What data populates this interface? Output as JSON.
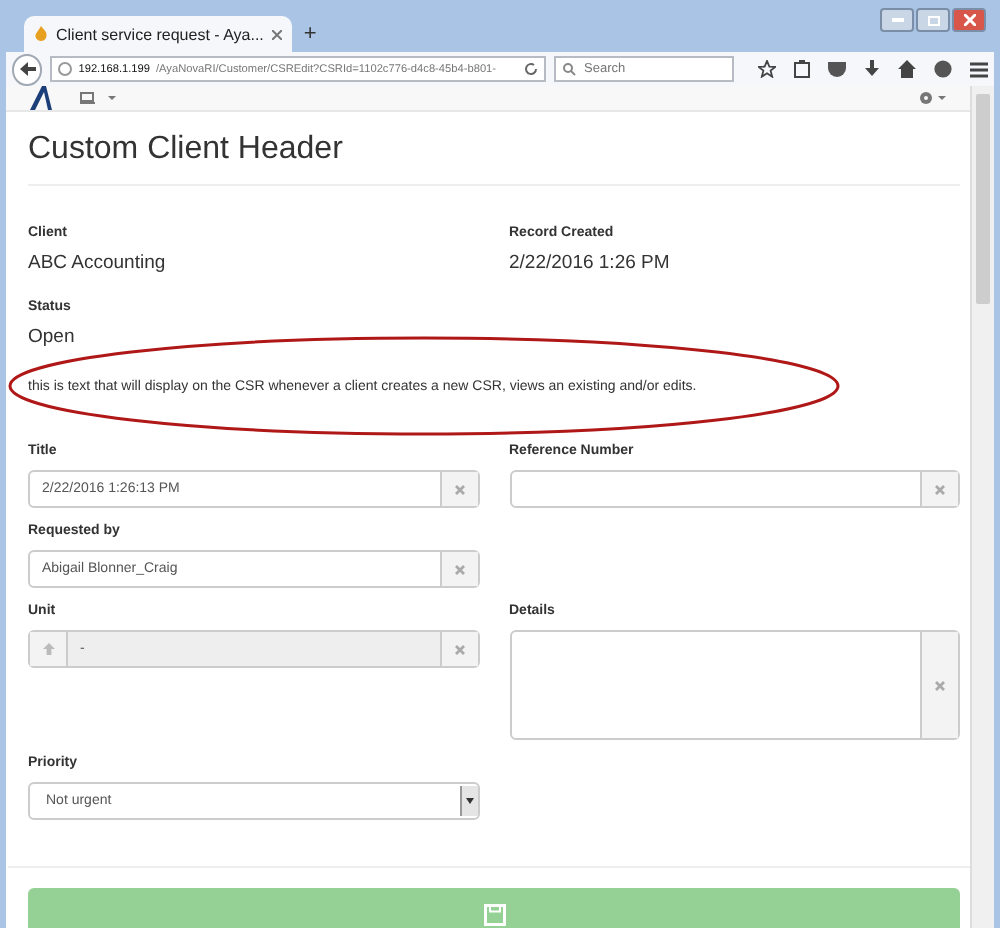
{
  "browser": {
    "tab_title": "Client service request - Aya...",
    "new_tab": "+",
    "url_host": "192.168.1.199",
    "url_path": "/AyaNovaRI/Customer/CSREdit?CSRId=1102c776-d4c8-45b4-b801-",
    "search_placeholder": "Search"
  },
  "page": {
    "header": "Custom Client Header",
    "info_rows": [
      [
        {
          "label": "Client",
          "value": "ABC Accounting"
        },
        {
          "label": "Record Created",
          "value": "2/22/2016 1:26 PM"
        }
      ],
      [
        {
          "label": "Status",
          "value": "Open"
        }
      ]
    ],
    "note": "this is text that will display on the CSR whenever a client creates a new CSR, views an existing and/or edits.",
    "field_rows": [
      {
        "left": {
          "kind": "text",
          "label": "Title",
          "value": "2/22/2016 1:26:13 PM"
        },
        "right": {
          "kind": "text",
          "label": "Reference Number"
        }
      },
      {
        "left": {
          "kind": "text",
          "label": "Requested by",
          "value": "Abigail Blonner_Craig"
        }
      },
      {
        "left": {
          "kind": "lookup",
          "label": "Unit",
          "value": "-",
          "disabled": true
        },
        "right": {
          "kind": "textarea",
          "label": "Details"
        }
      },
      {
        "left": {
          "kind": "select",
          "label": "Priority",
          "value": "Not urgent"
        }
      }
    ]
  }
}
